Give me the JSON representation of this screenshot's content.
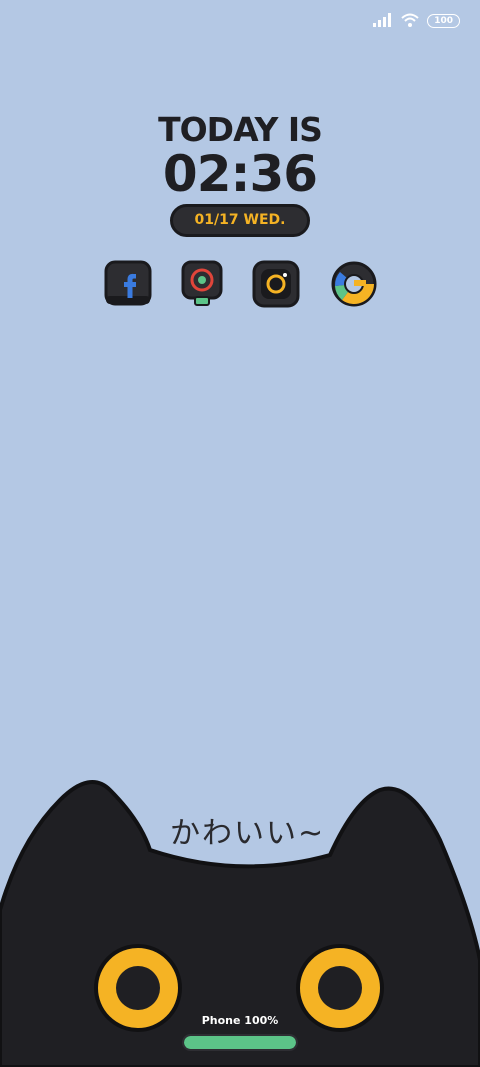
{
  "status_bar": {
    "signal_icon": "signal-icon",
    "wifi_icon": "wifi-icon",
    "battery_text": "100"
  },
  "clock": {
    "heading": "TODAY IS",
    "time": "02:36",
    "date": "01/17 WED."
  },
  "apps": [
    {
      "name": "facebook",
      "icon": "facebook-icon"
    },
    {
      "name": "camera-record",
      "icon": "record-icon"
    },
    {
      "name": "instagram",
      "icon": "instagram-icon"
    },
    {
      "name": "google",
      "icon": "google-icon"
    }
  ],
  "cat_widget": {
    "caption": "かわいい~",
    "phone_label": "Phone 100%",
    "phone_battery_fraction": 1.0
  },
  "colors": {
    "background": "#b4c8e4",
    "accent": "#f5b324",
    "cat": "#1f1f23",
    "battery_fill": "#5cc488"
  }
}
